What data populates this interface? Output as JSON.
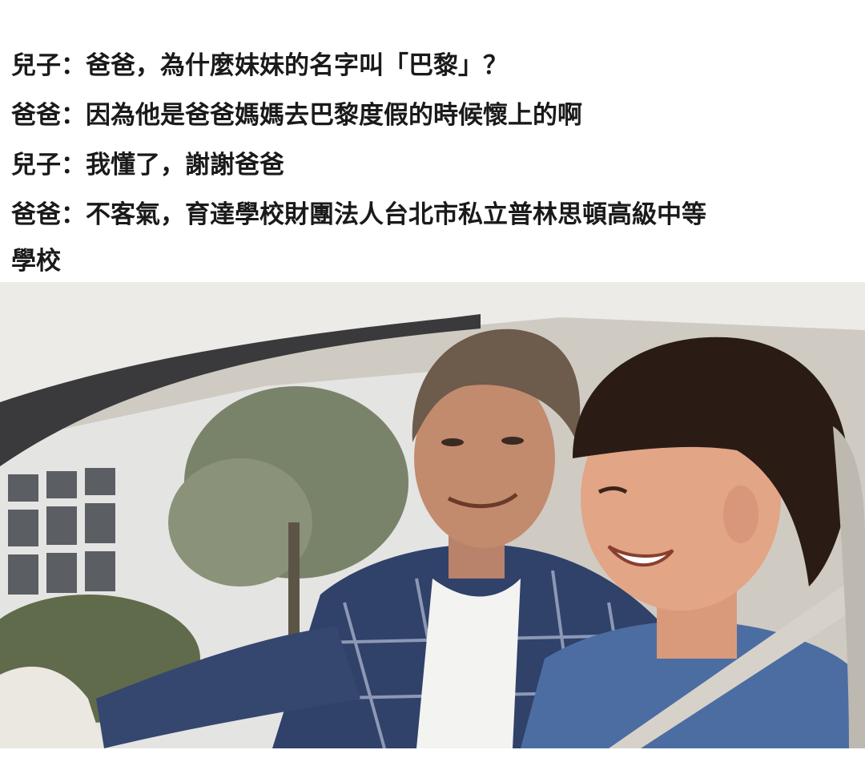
{
  "caption": {
    "lines": [
      "兒子：爸爸，為什麼妹妹的名字叫「巴黎」？",
      "爸爸：因為他是爸爸媽媽去巴黎度假的時候懷上的啊",
      "兒子：我懂了，謝謝爸爸",
      "爸爸：不客氣，育達學校財團法人台北市私立普林思頓高級中等",
      "學校"
    ]
  },
  "photo": {
    "scene": "father-and-son-in-car",
    "colors": {
      "car_roof": "#e9e7e3",
      "car_interior": "#c9c5bd",
      "window_pillar": "#3b3b3d",
      "outside_building": "#e6e6e6",
      "tree": "#6f7b5a",
      "father_hair": "#6b5a4c",
      "father_skin": "#c08a6a",
      "father_shirt": "#2f3f66",
      "tshirt": "#f4f4f2",
      "son_hair": "#2b1d16",
      "son_skin": "#e0a384",
      "son_shirt": "#4d6ea3",
      "steering_wheel": "#e9e6df"
    }
  }
}
